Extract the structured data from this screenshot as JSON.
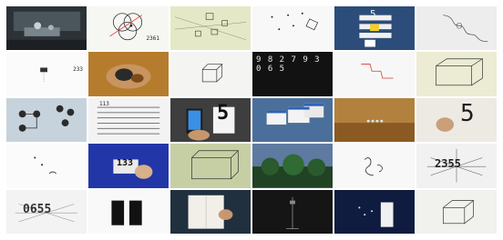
{
  "tiles": [
    {
      "name": "dark-desk-scene",
      "bg": "#2c3236"
    },
    {
      "name": "venn-circles-diagram",
      "bg": "#f6f6f3",
      "label": "2361"
    },
    {
      "name": "cubes-on-grid-sketch",
      "bg": "#e5e8c6"
    },
    {
      "name": "dots-and-cube-sketch",
      "bg": "#f8f8f8"
    },
    {
      "name": "blue-panel-number-five",
      "bg": "#2c4d79",
      "label": "5"
    },
    {
      "name": "squiggle-line-drawing",
      "bg": "#ededee"
    },
    {
      "name": "digit-lcd-tiny",
      "bg": "#fbfbfb",
      "label": "233"
    },
    {
      "name": "hands-on-wood-photo",
      "bg": "#b67c2d"
    },
    {
      "name": "cube-outline-sketch",
      "bg": "#f4f4f2"
    },
    {
      "name": "scattered-digits-black",
      "bg": "#121212",
      "label": "9 8 2 7 9 3 0 6 5"
    },
    {
      "name": "red-line-squiggle",
      "bg": "#f7f7f7"
    },
    {
      "name": "wireframe-box-cream",
      "bg": "#ecebd4"
    },
    {
      "name": "node-graph-diagram",
      "bg": "#c7d3dc"
    },
    {
      "name": "striped-page-lines",
      "bg": "#f3f3f3",
      "label": "113"
    },
    {
      "name": "phone-digit-photo",
      "bg": "#3e3e3e",
      "label": "5"
    },
    {
      "name": "windows-desktop-screens",
      "bg": "#4b6f9b"
    },
    {
      "name": "orange-wall-dots-photo",
      "bg": "#b2813e"
    },
    {
      "name": "hand-drawn-five",
      "bg": "#edeae4",
      "label": "5"
    },
    {
      "name": "white-minimal-dots",
      "bg": "#fbfbfb"
    },
    {
      "name": "blue-card-number",
      "bg": "#2236a8",
      "label": "133"
    },
    {
      "name": "perspective-box-green",
      "bg": "#c6cfa4"
    },
    {
      "name": "trees-and-sky-photo",
      "bg": "#5e7aa0"
    },
    {
      "name": "white-squiggle-small",
      "bg": "#f8f8f8"
    },
    {
      "name": "spiky-number-burst",
      "bg": "#f1f1f1",
      "label": "2355"
    },
    {
      "name": "fuzzy-number-white",
      "bg": "#f3f3f3",
      "label": "0655"
    },
    {
      "name": "black-blocks-on-white",
      "bg": "#f9f9f9"
    },
    {
      "name": "book-page-photo",
      "bg": "#21303f"
    },
    {
      "name": "dark-stand-silhouette",
      "bg": "#151515"
    },
    {
      "name": "blue-night-with-card",
      "bg": "#0f1c3f"
    },
    {
      "name": "cube-sketch-pale",
      "bg": "#f1f1ed"
    }
  ]
}
